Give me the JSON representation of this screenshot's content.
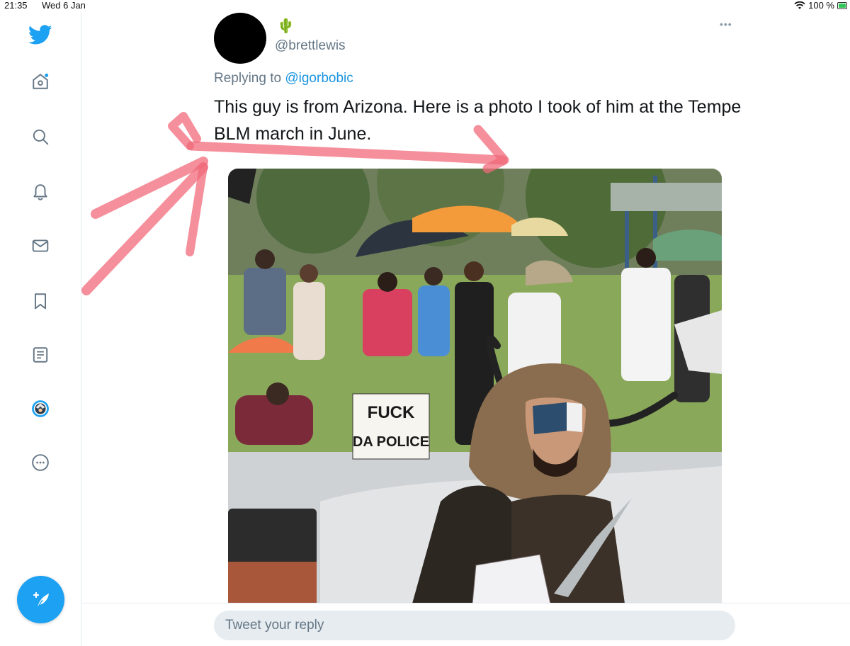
{
  "status_bar": {
    "time": "21:35",
    "date": "Wed 6 Jan",
    "battery": "100 %"
  },
  "sidebar": {
    "items": [
      {
        "icon": "twitter-logo-icon"
      },
      {
        "icon": "home-icon"
      },
      {
        "icon": "search-icon"
      },
      {
        "icon": "notifications-bell-icon"
      },
      {
        "icon": "messages-envelope-icon"
      },
      {
        "icon": "bookmark-icon"
      },
      {
        "icon": "lists-icon"
      },
      {
        "icon": "profile-avatar-icon"
      },
      {
        "icon": "more-options-icon"
      }
    ],
    "compose_icon": "compose-feather-icon"
  },
  "tweet": {
    "emoji": "🌵",
    "handle": "@brettlewis",
    "more_label": "•••",
    "replying_prefix": "Replying to",
    "replying_to": "@igorbobic",
    "text": "This guy is from Arizona. Here is a photo I took of him at the Tempe BLM march in June.",
    "photo": {
      "sign_line1": "FUCK",
      "sign_line2": "DA POLICE"
    }
  },
  "reply": {
    "placeholder": "Tweet your reply"
  },
  "colors": {
    "accent": "#1da1f2",
    "link": "#1b95e0",
    "secondary_text": "#657786",
    "annotation": "#f06a7a"
  }
}
